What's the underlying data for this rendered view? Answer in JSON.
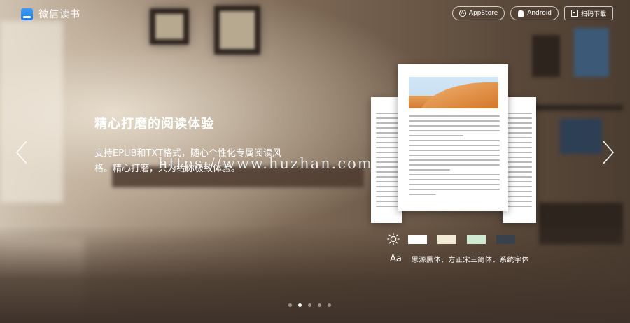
{
  "app": {
    "name": "微信读书"
  },
  "topbar": {
    "buttons": [
      {
        "label": "AppStore",
        "icon": "appstore-icon"
      },
      {
        "label": "Android",
        "icon": "android-icon"
      },
      {
        "label": "扫码下载",
        "icon": "qr-code-icon"
      }
    ]
  },
  "hero": {
    "title": "精心打磨的阅读体验",
    "description_line1": "支持EPUB和TXT格式，随心个性化专属阅读风",
    "description_line2": "格。精心打磨，只为给你极致体验。"
  },
  "watermark": "https://www.huzhan.com/ishop3572",
  "themes": {
    "brightness_icon": "sun-icon",
    "swatches": [
      "#ffffff",
      "#f3ead6",
      "#cfead0",
      "#37424c"
    ]
  },
  "fonts": {
    "icon_label": "Aa",
    "text": "思源黑体、方正宋三简体、系统字体"
  },
  "carousel": {
    "slide_count": 5,
    "active_index": 1
  }
}
